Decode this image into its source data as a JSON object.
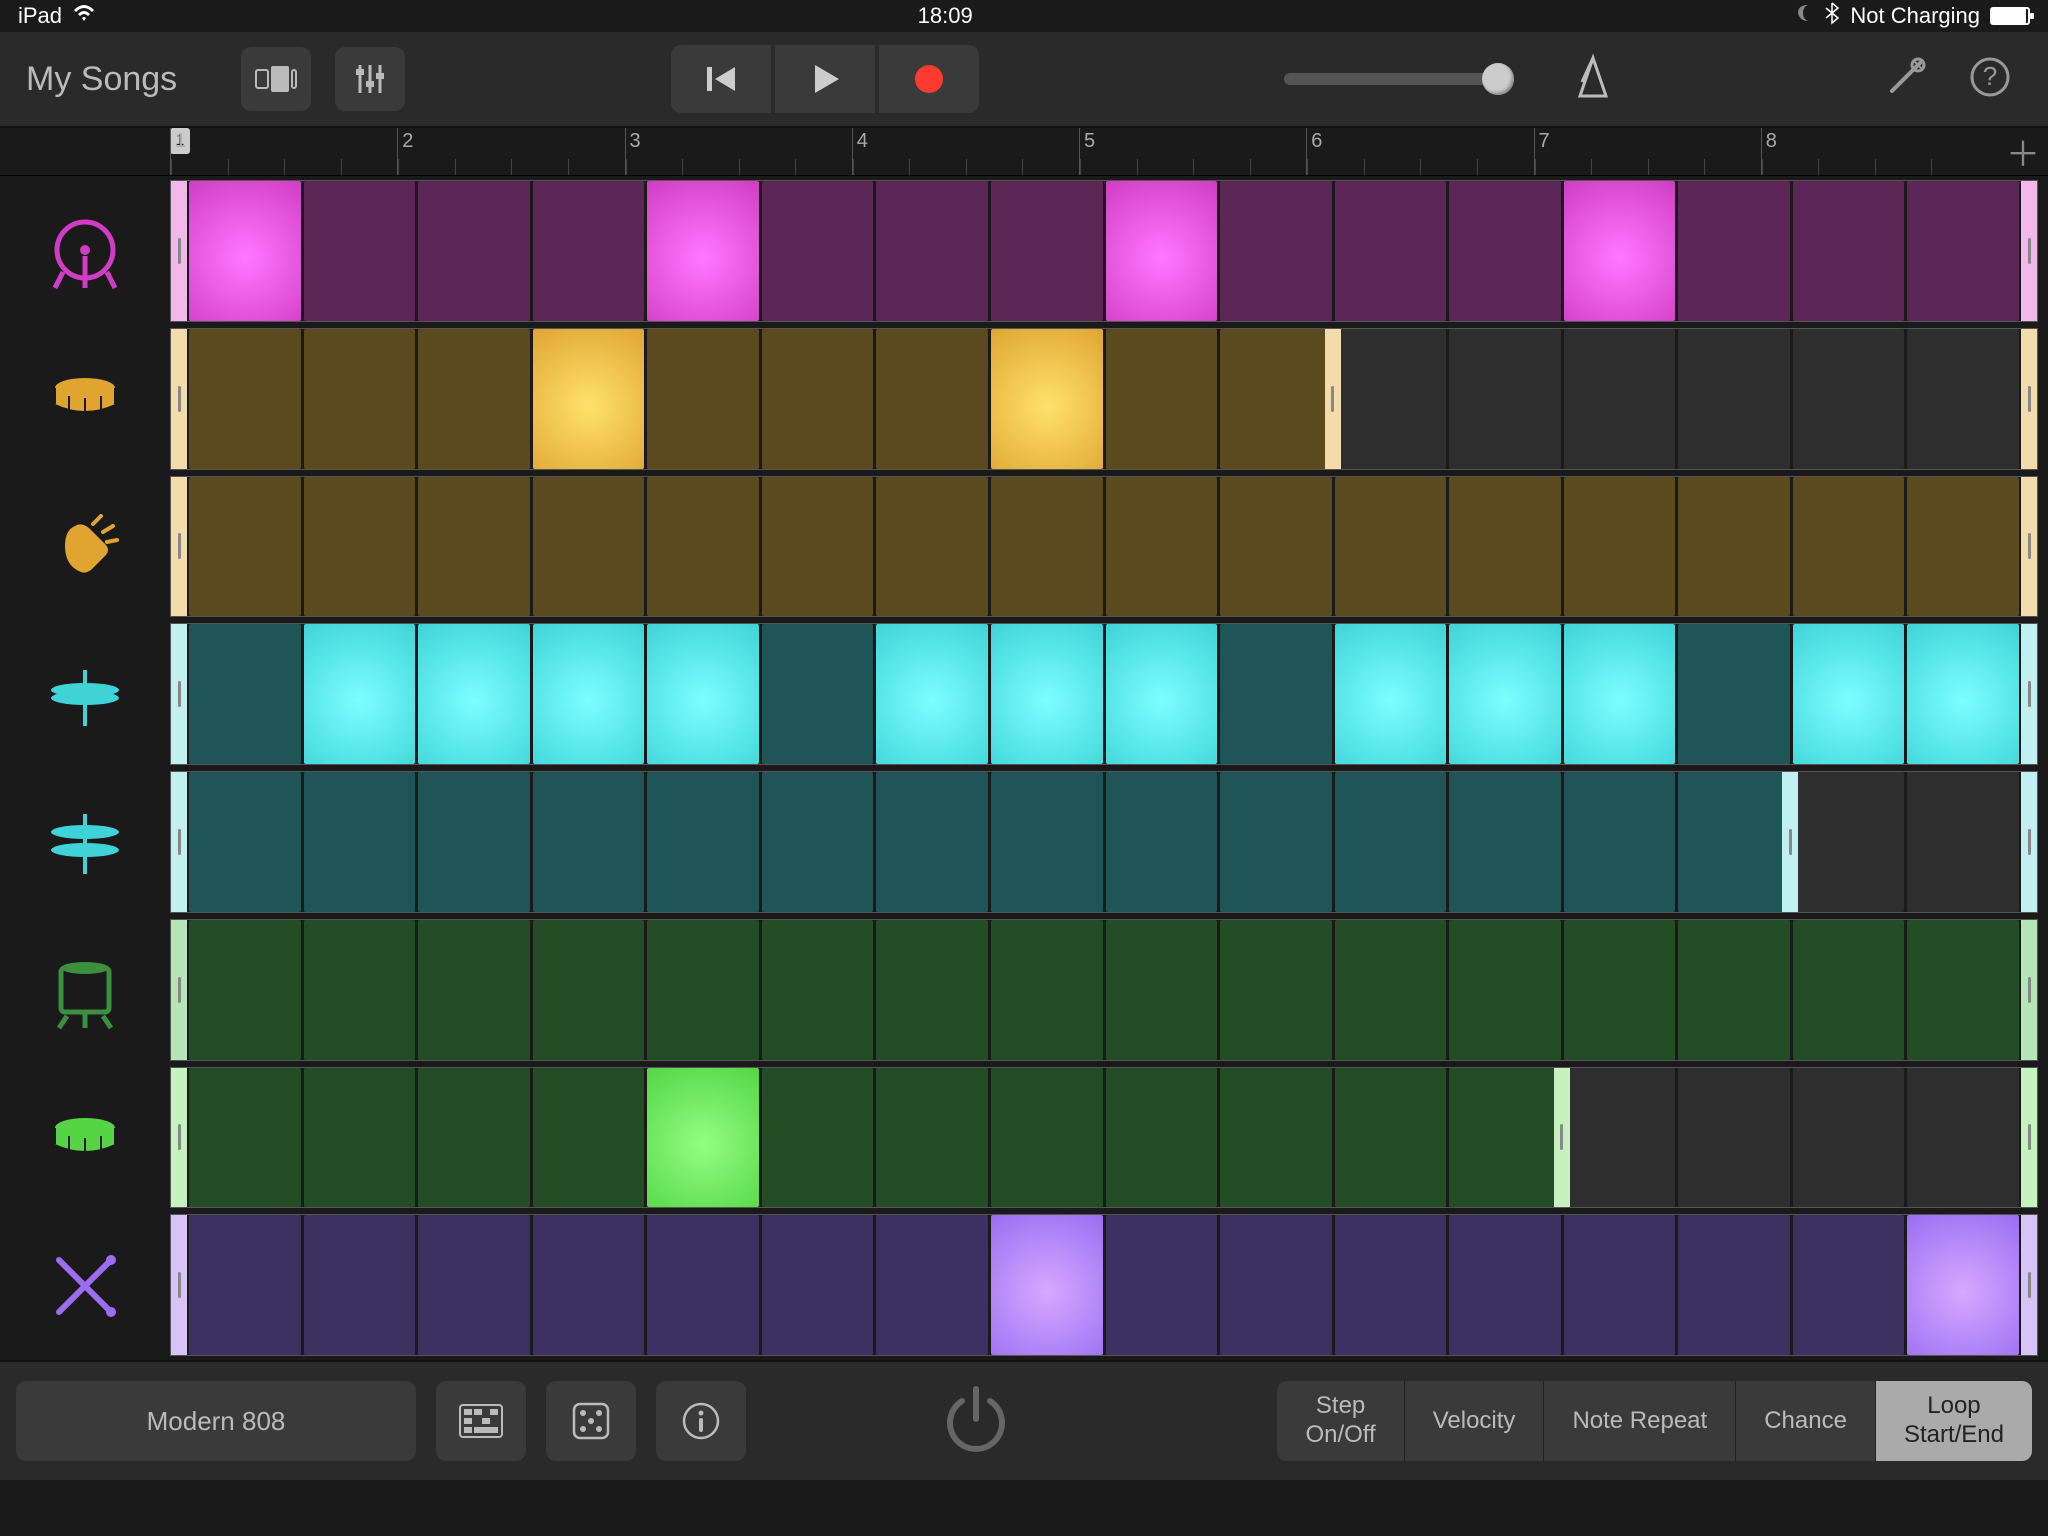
{
  "statusbar": {
    "device": "iPad",
    "time": "18:09",
    "charging": "Not Charging"
  },
  "topbar": {
    "back": "My Songs"
  },
  "ruler": {
    "bars": [
      "1",
      "2",
      "3",
      "4",
      "5",
      "6",
      "7",
      "8"
    ],
    "playhead": "1"
  },
  "tracks": [
    {
      "name": "kick",
      "color": "#d13cc4",
      "dim": "#5c2757",
      "off": "#2e2e2e",
      "handle": "#f0b9e9",
      "steps": 16,
      "loop_end": 16,
      "active": [
        0,
        4,
        8,
        12
      ]
    },
    {
      "name": "snare",
      "color": "#e0a531",
      "dim": "#5c4a1f",
      "off": "#2e2e2e",
      "handle": "#f3dcab",
      "steps": 16,
      "loop_end": 10,
      "active": [
        3,
        7
      ]
    },
    {
      "name": "clap",
      "color": "#e0a531",
      "dim": "#5c4a1f",
      "off": "#2e2e2e",
      "handle": "#f3dcab",
      "steps": 16,
      "loop_end": 16,
      "active": []
    },
    {
      "name": "hihat-closed",
      "color": "#3fd3d8",
      "dim": "#1f5557",
      "off": "#2e2e2e",
      "handle": "#c1f0f1",
      "steps": 16,
      "loop_end": 16,
      "active": [
        1,
        2,
        3,
        4,
        6,
        7,
        8,
        10,
        11,
        12,
        14,
        15
      ]
    },
    {
      "name": "hihat-open",
      "color": "#3fd3d8",
      "dim": "#1f5557",
      "off": "#2e2e2e",
      "handle": "#c1f0f1",
      "steps": 16,
      "loop_end": 14,
      "active": []
    },
    {
      "name": "tom",
      "color": "#3b8f3e",
      "dim": "#234d25",
      "off": "#2e2e2e",
      "handle": "#b6e6b7",
      "steps": 16,
      "loop_end": 16,
      "active": []
    },
    {
      "name": "snare2",
      "color": "#55d545",
      "dim": "#234d25",
      "off": "#2e2e2e",
      "handle": "#c5f2be",
      "steps": 16,
      "loop_end": 12,
      "active": [
        4
      ]
    },
    {
      "name": "sticks",
      "color": "#9a6df2",
      "dim": "#3d3161",
      "off": "#2e2e2e",
      "handle": "#d6c3f7",
      "steps": 16,
      "loop_end": 16,
      "active": [
        7,
        15
      ]
    }
  ],
  "bottom": {
    "kit": "Modern 808",
    "modes": [
      "Step\nOn/Off",
      "Velocity",
      "Note Repeat",
      "Chance",
      "Loop\nStart/End"
    ],
    "selected_mode": 4
  }
}
